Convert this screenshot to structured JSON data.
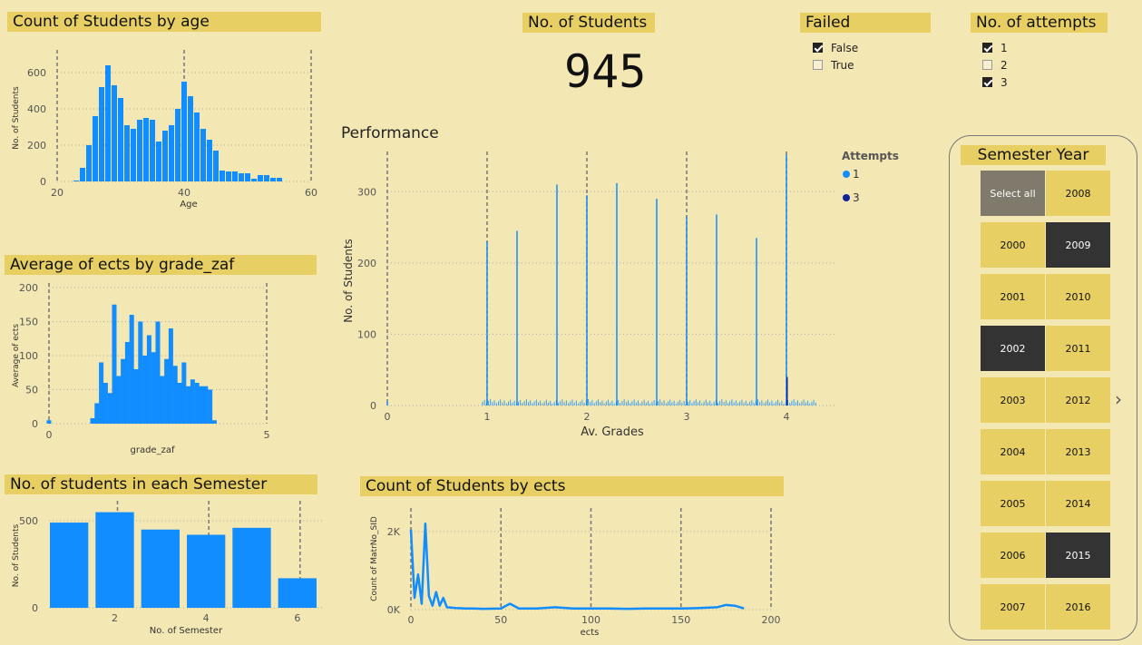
{
  "colors": {
    "bar": "#118dff",
    "dark_series": "#12239e",
    "header_bg": "#e7cf63",
    "bg": "#f3e7b3"
  },
  "kpi": {
    "title": "No. of Students",
    "value": "945"
  },
  "failed_slicer": {
    "title": "Failed",
    "items": [
      {
        "label": "False",
        "checked": true
      },
      {
        "label": "True",
        "checked": false
      }
    ]
  },
  "attempts_slicer": {
    "title": "No. of attempts",
    "items": [
      {
        "label": "1",
        "checked": true
      },
      {
        "label": "2",
        "checked": false
      },
      {
        "label": "3",
        "checked": true
      }
    ]
  },
  "semester_slicer": {
    "title": "Semester Year",
    "next_icon": "chevron-right-icon",
    "buttons": [
      {
        "label": "Select all",
        "state": "grey"
      },
      {
        "label": "2008",
        "state": "normal"
      },
      {
        "label": "2000",
        "state": "normal"
      },
      {
        "label": "2009",
        "state": "selected"
      },
      {
        "label": "2001",
        "state": "normal"
      },
      {
        "label": "2010",
        "state": "normal"
      },
      {
        "label": "2002",
        "state": "selected"
      },
      {
        "label": "2011",
        "state": "normal"
      },
      {
        "label": "2003",
        "state": "normal"
      },
      {
        "label": "2012",
        "state": "normal"
      },
      {
        "label": "2004",
        "state": "normal"
      },
      {
        "label": "2013",
        "state": "normal"
      },
      {
        "label": "2005",
        "state": "normal"
      },
      {
        "label": "2014",
        "state": "normal"
      },
      {
        "label": "2006",
        "state": "normal"
      },
      {
        "label": "2015",
        "state": "selected"
      },
      {
        "label": "2007",
        "state": "normal"
      },
      {
        "label": "2016",
        "state": "normal"
      }
    ]
  },
  "chart_data": [
    {
      "id": "age",
      "type": "bar",
      "title": "Count of Students by age",
      "xlabel": "Age",
      "ylabel": "No. of Students",
      "xlim": [
        20,
        60
      ],
      "ylim": [
        0,
        700
      ],
      "xticks": [
        20,
        40,
        60
      ],
      "yticks": [
        0,
        200,
        400,
        600
      ],
      "x": [
        23,
        24,
        25,
        26,
        27,
        28,
        29,
        30,
        31,
        32,
        33,
        34,
        35,
        36,
        37,
        38,
        39,
        40,
        41,
        42,
        43,
        44,
        45,
        46,
        47,
        48,
        49,
        50,
        51,
        52,
        53,
        54,
        55
      ],
      "values": [
        5,
        75,
        200,
        360,
        520,
        640,
        530,
        460,
        310,
        290,
        340,
        350,
        340,
        220,
        280,
        310,
        400,
        550,
        470,
        380,
        290,
        230,
        170,
        60,
        55,
        55,
        45,
        45,
        15,
        35,
        35,
        20,
        20
      ]
    },
    {
      "id": "ects_grade",
      "type": "bar",
      "title": "Average of ects by grade_zaf",
      "xlabel": "grade_zaf",
      "ylabel": "Average of ects",
      "xlim": [
        0,
        5
      ],
      "ylim": [
        0,
        200
      ],
      "xticks": [
        0,
        5
      ],
      "yticks": [
        0,
        50,
        100,
        150,
        200
      ],
      "x": [
        0,
        1.0,
        1.1,
        1.2,
        1.3,
        1.4,
        1.5,
        1.6,
        1.7,
        1.8,
        1.9,
        2.0,
        2.1,
        2.2,
        2.3,
        2.4,
        2.5,
        2.6,
        2.7,
        2.8,
        2.9,
        3.0,
        3.1,
        3.2,
        3.3,
        3.4,
        3.5,
        3.6,
        3.7,
        3.8
      ],
      "values": [
        5,
        8,
        30,
        90,
        60,
        45,
        175,
        70,
        95,
        120,
        160,
        80,
        150,
        100,
        130,
        105,
        150,
        70,
        95,
        140,
        85,
        60,
        90,
        55,
        65,
        60,
        55,
        55,
        50,
        5
      ]
    },
    {
      "id": "semester",
      "type": "bar",
      "title": "No. of students in each Semester",
      "xlabel": "No. of Semester",
      "ylabel": "No. of Students",
      "categories": [
        1,
        2,
        3,
        4,
        5,
        6
      ],
      "values": [
        490,
        550,
        450,
        420,
        460,
        170
      ],
      "ylim": [
        0,
        600
      ],
      "xticks": [
        2,
        4,
        6
      ],
      "yticks": [
        0,
        500
      ]
    },
    {
      "id": "performance",
      "type": "bar",
      "title": "Performance",
      "xlabel": "Av. Grades",
      "ylabel": "No. of Students",
      "xlim": [
        0,
        4.5
      ],
      "ylim": [
        0,
        350
      ],
      "xticks": [
        0,
        1,
        2,
        3,
        4
      ],
      "yticks": [
        0,
        100,
        200,
        300
      ],
      "legend": {
        "title": "Attempts",
        "position": "top-right",
        "items": [
          {
            "name": "1",
            "color": "#118dff"
          },
          {
            "name": "3",
            "color": "#12239e"
          }
        ]
      },
      "x": [
        0,
        1.0,
        1.3,
        1.7,
        2.0,
        2.3,
        2.7,
        3.0,
        3.3,
        3.7,
        4.0
      ],
      "values": [
        5,
        230,
        245,
        310,
        295,
        312,
        290,
        265,
        268,
        235,
        352
      ]
    },
    {
      "id": "ects_count",
      "type": "line",
      "title": "Count of Students by ects",
      "xlabel": "ects",
      "ylabel": "Count of MatrNo_SID",
      "xlim": [
        0,
        200
      ],
      "ylim": [
        0,
        2600
      ],
      "xticks": [
        0,
        50,
        100,
        150,
        200
      ],
      "yticks": [
        {
          "v": 0,
          "label": "0K"
        },
        {
          "v": 2000,
          "label": "2K"
        }
      ],
      "x": [
        0,
        2,
        4,
        6,
        8,
        10,
        12,
        14,
        16,
        18,
        20,
        25,
        30,
        35,
        40,
        50,
        55,
        60,
        70,
        80,
        90,
        100,
        110,
        120,
        130,
        140,
        150,
        160,
        170,
        175,
        180,
        185
      ],
      "values": [
        2050,
        300,
        900,
        150,
        2200,
        350,
        100,
        450,
        100,
        300,
        60,
        40,
        30,
        30,
        20,
        30,
        150,
        30,
        30,
        60,
        30,
        30,
        30,
        20,
        30,
        30,
        30,
        40,
        60,
        120,
        100,
        30
      ]
    }
  ]
}
